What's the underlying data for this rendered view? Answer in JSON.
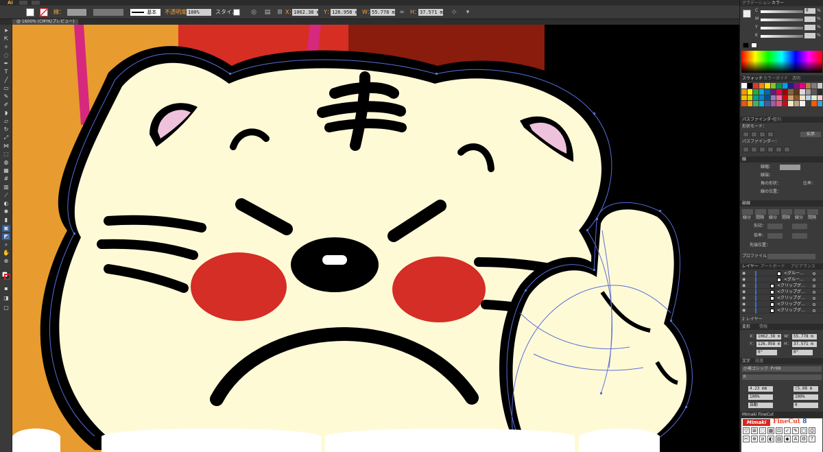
{
  "app": {
    "logo": "Ai",
    "menu_icons": [
      "window-icon",
      "arrange-icon"
    ]
  },
  "controlbar": {
    "fill_label": "線：",
    "stroke_style": "基本",
    "opacity_label": "不透明度：",
    "opacity_value": "100%",
    "style_label": "スタイル：",
    "x_label": "X：",
    "x_value": "1062.38 m",
    "y_label": "Y：",
    "y_value": "126.958 m",
    "w_label": "W：",
    "w_value": "55.778 mm",
    "h_label": "H：",
    "h_value": "37.571 mm"
  },
  "document": {
    "tab_label": "@ 1600% (CMYK/プレビュー)"
  },
  "colors": {
    "orange": "#E89B2E",
    "red": "#D72E24",
    "dark_red": "#8A1C0D",
    "black": "#000000",
    "cream": "#FFFAD6",
    "magenta": "#D6287D",
    "pink": "#EEC2DC",
    "cheek": "#D42E26",
    "path_blue": "#5a6fd8"
  },
  "panels": {
    "gradient_tab": "グラデーション",
    "color_tab": "カラー",
    "cmyk": [
      {
        "label": "C",
        "value": "0",
        "unit": "%"
      },
      {
        "label": "M",
        "value": "",
        "unit": "%"
      },
      {
        "label": "Y",
        "value": "",
        "unit": "%"
      },
      {
        "label": "K",
        "value": "",
        "unit": "%"
      }
    ],
    "swatch_tabs": [
      "スウォッチ",
      "カラーガイド",
      "透明"
    ],
    "pathfinder_tabs": [
      "パスファインダー",
      "整列"
    ],
    "shape_modes_label": "形状モード：",
    "expand_button": "拡張",
    "pathfinder_label": "パスファインダー：",
    "stroke_tab": "線",
    "stroke_weight_label": "線幅：",
    "corner_label": "線端：",
    "join_label": "角の形状：",
    "limit_label": "比率：",
    "align_stroke_label": "線の位置：",
    "dash_tab": "破線",
    "dash_labels": [
      "線分",
      "間隔",
      "線分",
      "間隔",
      "線分",
      "間隔"
    ],
    "arrow_label": "矢印：",
    "scale_label": "倍率：",
    "align_arrow_label": "先端位置：",
    "profile_label": "プロファイル：",
    "layer_tabs": [
      "レイヤー",
      "アートボード",
      "アピアランス"
    ],
    "layers": [
      {
        "name": "<グルー..."
      },
      {
        "name": "<グルー..."
      },
      {
        "name": "<クリップグ..."
      },
      {
        "name": "<クリップグ..."
      },
      {
        "name": "<クリップグ..."
      },
      {
        "name": "<クリップグ..."
      },
      {
        "name": "<クリップグ..."
      }
    ],
    "layer_count": "2 レイヤー",
    "transform_tabs": [
      "変形",
      "情報"
    ],
    "t_x_label": "X：",
    "t_x_value": "1062.38 m",
    "t_w_label": "W：",
    "t_w_value": "55.778 m",
    "t_y_label": "Y：",
    "t_y_value": "126.958 m",
    "t_h_label": "H：",
    "t_h_value": "37.571 m",
    "t_angle": "0°",
    "t_shear": "0°",
    "char_tabs": [
      "文字",
      "段落"
    ],
    "font_name": "小塚ゴシック Pr6N",
    "font_style": "R",
    "font_size": "4.23 mm",
    "leading": "(5.08 m",
    "v_scale": "100%",
    "h_scale": "100%",
    "kerning": "自動",
    "tracking": "0",
    "finecut_title": "Mimaki FineCut",
    "finecut_logo": "Mimaki",
    "finecut_product": "FineCut",
    "finecut_version": "8"
  }
}
